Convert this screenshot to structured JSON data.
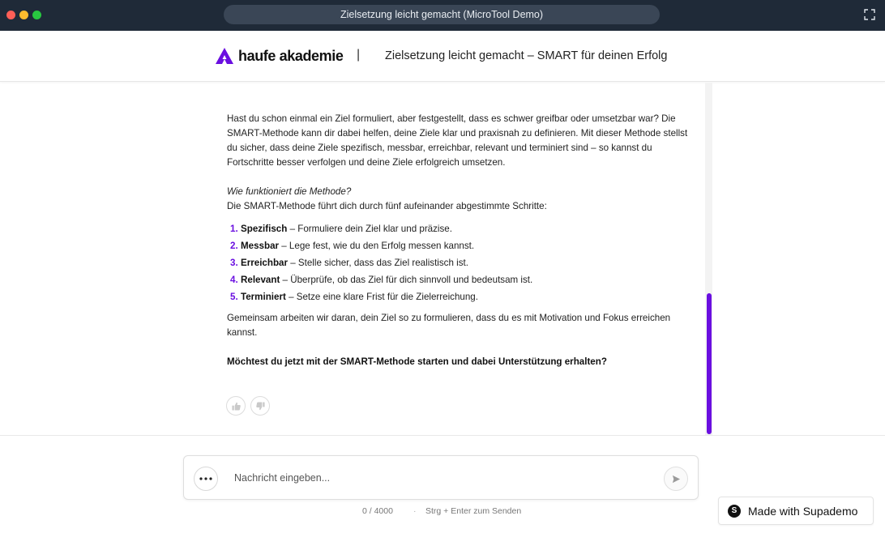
{
  "window": {
    "title": "Zielsetzung leicht gemacht (MicroTool Demo)"
  },
  "header": {
    "brand": "haufe akademie",
    "divider": "|",
    "title": "Zielsetzung leicht gemacht – SMART für deinen Erfolg",
    "accent_color": "#6a0fe0"
  },
  "message": {
    "intro": "Hast du schon einmal ein Ziel formuliert, aber festgestellt, dass es schwer greifbar oder umsetzbar war? Die SMART-Methode kann dir dabei helfen, deine Ziele klar und praxisnah zu definieren. Mit dieser Methode stellst du sicher, dass deine Ziele spezifisch, messbar, erreichbar, relevant und terminiert sind – so kannst du Fortschritte besser verfolgen und deine Ziele erfolgreich umsetzen.",
    "question": "Wie funktioniert die Methode?",
    "steps_intro": "Die SMART-Methode führt dich durch fünf aufeinander abgestimmte Schritte:",
    "steps": [
      {
        "num": "1.",
        "term": "Spezifisch",
        "text": " – Formuliere dein Ziel klar und präzise."
      },
      {
        "num": "2.",
        "term": "Messbar",
        "text": " – Lege fest, wie du den Erfolg messen kannst."
      },
      {
        "num": "3.",
        "term": "Erreichbar",
        "text": " – Stelle sicher, dass das Ziel realistisch ist."
      },
      {
        "num": "4.",
        "term": "Relevant",
        "text": " – Überprüfe, ob das Ziel für dich sinnvoll und bedeutsam ist."
      },
      {
        "num": "5.",
        "term": "Terminiert",
        "text": " – Setze eine klare Frist für die Zielerreichung."
      }
    ],
    "outro": "Gemeinsam arbeiten wir daran, dein Ziel so zu formulieren, dass du es mit Motivation und Fokus erreichen kannst.",
    "cta": "Möchtest du jetzt mit der SMART-Methode starten und dabei Unterstützung erhalten?",
    "feedback_icons": [
      "thumbs-up-icon",
      "thumbs-down-icon"
    ]
  },
  "composer": {
    "placeholder": "Nachricht eingeben...",
    "value": "",
    "more_icon": "more-horizontal-icon",
    "send_icon": "send-icon",
    "char_count": "0 /  4000",
    "separator": "·",
    "hint": "Strg + Enter zum Senden"
  },
  "badge": {
    "label": "Made with Supademo",
    "icon_letter": "S"
  }
}
